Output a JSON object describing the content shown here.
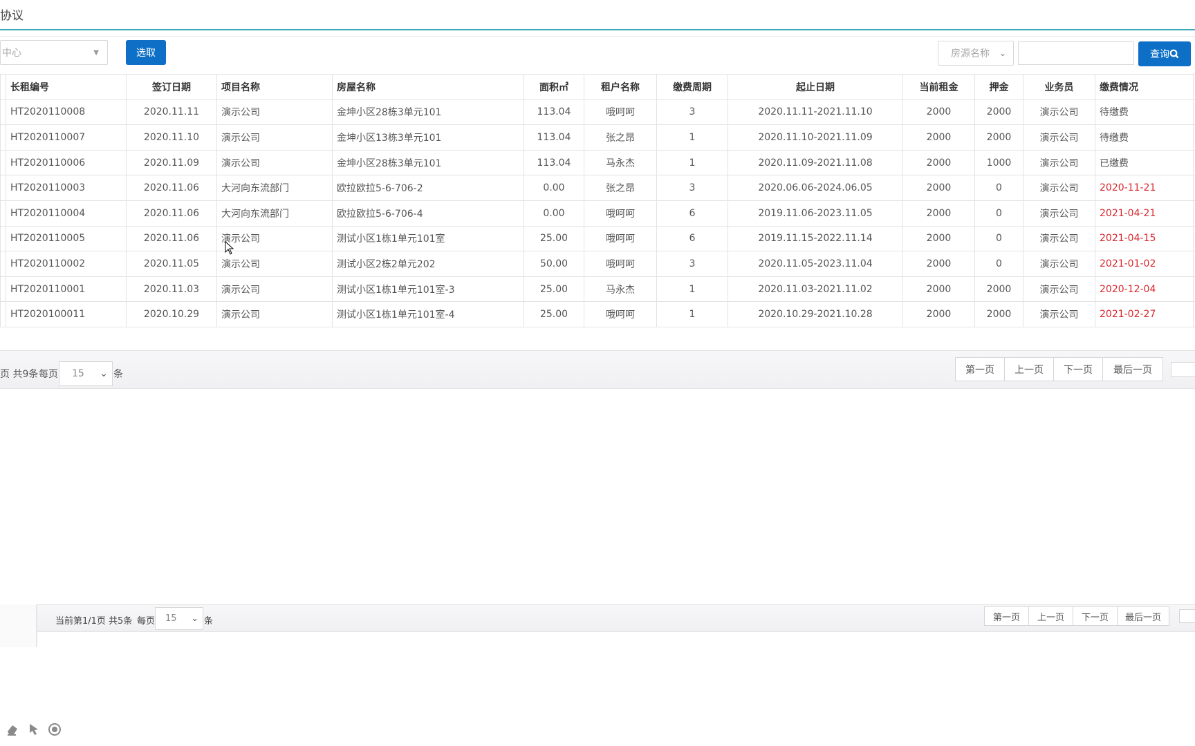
{
  "header": {
    "title": "协议"
  },
  "toolbar": {
    "org_select": "中心",
    "pick_button": "选取",
    "search_field_select": "房源名称",
    "search_value": "",
    "query_button": "查询",
    "accent": "#0d6fc5"
  },
  "table": {
    "columns": [
      "长租编号",
      "签订日期",
      "项目名称",
      "房屋名称",
      "面积㎡",
      "租户名称",
      "缴费周期",
      "起止日期",
      "当前租金",
      "押金",
      "业务员",
      "缴费情况"
    ],
    "rows": [
      [
        "HT2020110008",
        "2020.11.11",
        "演示公司",
        "金坤小区28栋3单元101",
        "113.04",
        "哦呵呵",
        "3",
        "2020.11.11-2021.11.10",
        "2000",
        "2000",
        "演示公司",
        "待缴费"
      ],
      [
        "HT2020110007",
        "2020.11.10",
        "演示公司",
        "金坤小区13栋3单元101",
        "113.04",
        "张之昂",
        "1",
        "2020.11.10-2021.11.09",
        "2000",
        "2000",
        "演示公司",
        "待缴费"
      ],
      [
        "HT2020110006",
        "2020.11.09",
        "演示公司",
        "金坤小区28栋3单元101",
        "113.04",
        "马永杰",
        "1",
        "2020.11.09-2021.11.08",
        "2000",
        "1000",
        "演示公司",
        "已缴费"
      ],
      [
        "HT2020110003",
        "2020.11.06",
        "大河向东流部门",
        "欧拉欧拉5-6-706-2",
        "0.00",
        "张之昂",
        "3",
        "2020.06.06-2024.06.05",
        "2000",
        "0",
        "演示公司",
        "2020-11-21"
      ],
      [
        "HT2020110004",
        "2020.11.06",
        "大河向东流部门",
        "欧拉欧拉5-6-706-4",
        "0.00",
        "哦呵呵",
        "6",
        "2019.11.06-2023.11.05",
        "2000",
        "0",
        "演示公司",
        "2021-04-21"
      ],
      [
        "HT2020110005",
        "2020.11.06",
        "演示公司",
        "测试小区1栋1单元101室",
        "25.00",
        "哦呵呵",
        "6",
        "2019.11.15-2022.11.14",
        "2000",
        "0",
        "演示公司",
        "2021-04-15"
      ],
      [
        "HT2020110002",
        "2020.11.05",
        "演示公司",
        "测试小区2栋2单元202",
        "50.00",
        "哦呵呵",
        "3",
        "2020.11.05-2023.11.04",
        "2000",
        "0",
        "演示公司",
        "2021-01-02"
      ],
      [
        "HT2020110001",
        "2020.11.03",
        "演示公司",
        "测试小区1栋1单元101室-3",
        "25.00",
        "马永杰",
        "1",
        "2020.11.03-2021.11.02",
        "2000",
        "2000",
        "演示公司",
        "2020-12-04"
      ],
      [
        "HT2020100011",
        "2020.10.29",
        "演示公司",
        "测试小区1栋1单元101室-4",
        "25.00",
        "哦呵呵",
        "1",
        "2020.10.29-2021.10.28",
        "2000",
        "2000",
        "演示公司",
        "2021-02-27"
      ]
    ],
    "overdue_color": "#d9272e"
  },
  "pager1": {
    "info": "页 共9条",
    "per_page_label": "每页",
    "per_page": "15",
    "unit": "条",
    "first": "第一页",
    "prev": "上一页",
    "next": "下一页",
    "last": "最后一页"
  },
  "pager2": {
    "info": "当前第1/1页 共5条",
    "per_page_label": "每页",
    "per_page": "15",
    "unit": "条",
    "first": "第一页",
    "prev": "上一页",
    "next": "下一页",
    "last": "最后一页"
  },
  "bottom_icons": [
    "eraser-icon",
    "pointer-icon",
    "record-icon"
  ]
}
